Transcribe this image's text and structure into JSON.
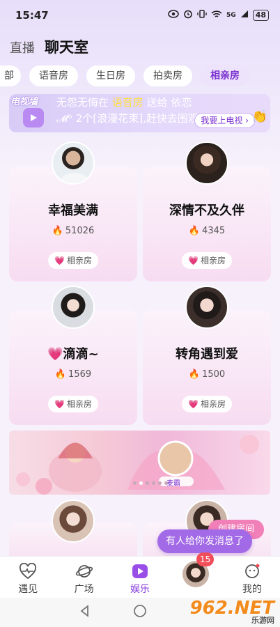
{
  "status_bar": {
    "time": "15:47",
    "network": "5G",
    "battery": "48"
  },
  "header": {
    "tab_live": "直播",
    "tab_chat": "聊天室"
  },
  "categories": [
    {
      "label": "部"
    },
    {
      "label": "语音房"
    },
    {
      "label": "生日房"
    },
    {
      "label": "拍卖房"
    },
    {
      "label": "相亲房"
    }
  ],
  "tv_banner": {
    "logo": "电视墙",
    "sender": "无怨无悔在",
    "room": "语音房",
    "verb": "送给",
    "receiver": "依恋",
    "line2_name": "𝓜ᵒ",
    "gift": "2个[浪漫花束],赶快去围观吧",
    "button": "我要上电视"
  },
  "rooms": [
    {
      "name": "幸福美满",
      "hot": "51026",
      "tag": "相亲房"
    },
    {
      "name": "深情不及久伴",
      "hot": "4345",
      "tag": "相亲房"
    },
    {
      "name": "💗滴滴~",
      "hot": "1569",
      "tag": "相亲房"
    },
    {
      "name": "转角遇到爱",
      "hot": "1500",
      "tag": "相亲房"
    }
  ],
  "promo_banner": {
    "caption": "麦霸"
  },
  "create_room_button": "创建房间",
  "toast": "有人给你发消息了",
  "tabbar": {
    "items": [
      {
        "label": "遇见"
      },
      {
        "label": "广场"
      },
      {
        "label": "娱乐"
      },
      {
        "label": ""
      },
      {
        "label": "我的"
      }
    ],
    "badge": "15"
  },
  "watermark": {
    "text": "962.NET",
    "sub": "乐游网"
  },
  "colors": {
    "accent": "#8a3fe0",
    "card_pink": "#f7dcf1",
    "fire": "#f05a28",
    "toast": "#a26ae6"
  }
}
